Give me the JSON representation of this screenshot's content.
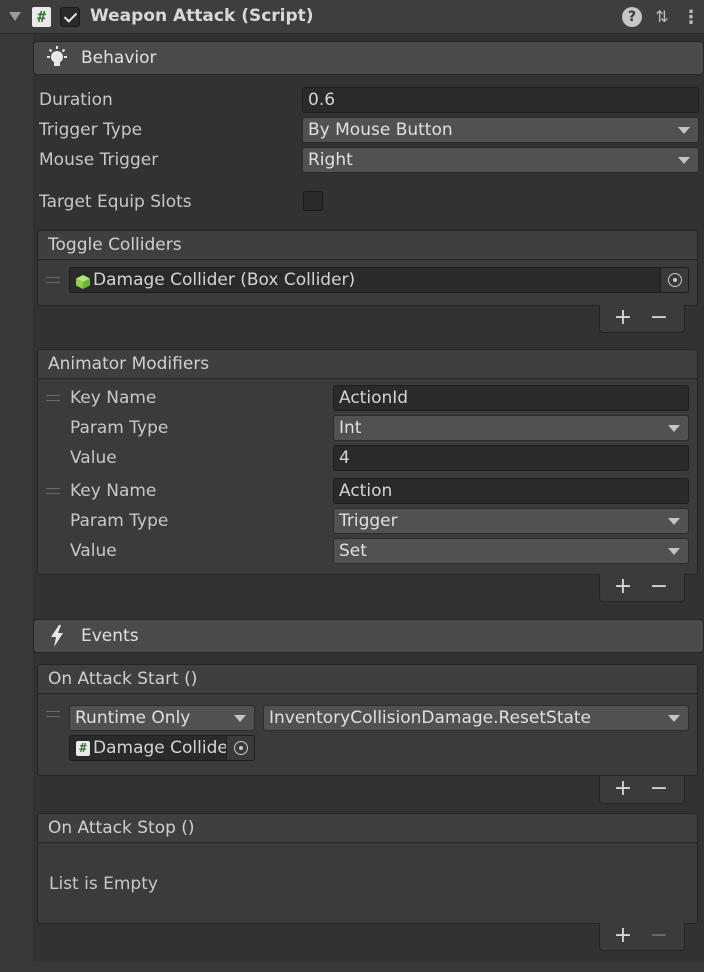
{
  "header": {
    "title": "Weapon Attack (Script)",
    "script_icon": "#",
    "enabled": true,
    "help_icon": "?",
    "presets_icon": "⇅",
    "menu_icon": "⋮"
  },
  "behavior": {
    "section_label": "Behavior",
    "section_icon": "lightbulb-icon",
    "duration_label": "Duration",
    "duration_value": "0.6",
    "trigger_type_label": "Trigger Type",
    "trigger_type_value": "By Mouse Button",
    "mouse_trigger_label": "Mouse Trigger",
    "mouse_trigger_value": "Right",
    "target_equip_slots_label": "Target Equip Slots",
    "target_equip_slots_checked": false
  },
  "toggle_colliders": {
    "header": "Toggle Colliders",
    "items": [
      {
        "value": "Damage Collider (Box Collider)",
        "icon": "box-collider-icon"
      }
    ],
    "add_label": "+",
    "remove_label": "−"
  },
  "animator_modifiers": {
    "header": "Animator Modifiers",
    "items": [
      {
        "key_name_label": "Key Name",
        "key_name_value": "ActionId",
        "param_type_label": "Param Type",
        "param_type_value": "Int",
        "value_label": "Value",
        "value_value": "4"
      },
      {
        "key_name_label": "Key Name",
        "key_name_value": "Action",
        "param_type_label": "Param Type",
        "param_type_value": "Trigger",
        "value_label": "Value",
        "value_value": "Set"
      }
    ],
    "add_label": "+",
    "remove_label": "−"
  },
  "events": {
    "section_label": "Events",
    "section_icon": "lightning-icon",
    "on_attack_start": {
      "header": "On Attack Start ()",
      "items": [
        {
          "call_state": "Runtime Only",
          "function": "InventoryCollisionDamage.ResetState",
          "target": "Damage Collide"
        }
      ],
      "add_label": "+",
      "remove_label": "−"
    },
    "on_attack_stop": {
      "header": "On Attack Stop ()",
      "empty_text": "List is Empty",
      "add_label": "+",
      "remove_label": "−"
    }
  },
  "colors": {
    "background": "#383838",
    "field": "#2a2a2a",
    "dropdown": "#515151",
    "section_header": "#4a4a4a",
    "box_collider_icon": "#8fd14f",
    "script_icon_green": "#3a7a3a"
  }
}
